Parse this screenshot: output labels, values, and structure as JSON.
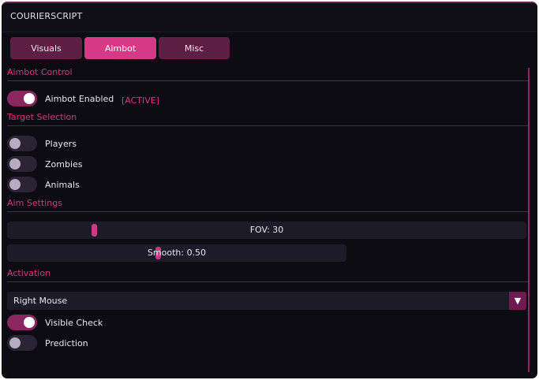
{
  "window": {
    "title": "COURIERSCRIPT"
  },
  "tabs": [
    {
      "label": "Visuals",
      "active": false
    },
    {
      "label": "Aimbot",
      "active": true
    },
    {
      "label": "Misc",
      "active": false
    }
  ],
  "colors": {
    "accent": "#cc3a83",
    "tab_active": "#d63a86",
    "tab_inactive": "#5d1f44",
    "background": "#0d0c12"
  },
  "aimbot_control": {
    "heading": "Aimbot Control",
    "aimbot_enabled": {
      "label": "Aimbot Enabled",
      "on": true,
      "status": "[ACTIVE]"
    }
  },
  "target_selection": {
    "heading": "Target Selection",
    "players": {
      "label": "Players",
      "on": false
    },
    "zombies": {
      "label": "Zombies",
      "on": false
    },
    "animals": {
      "label": "Animals",
      "on": false
    }
  },
  "aim_settings": {
    "heading": "Aim Settings",
    "fov": {
      "text": "FOV: 30",
      "value": 30,
      "fraction": 0.17
    },
    "smooth": {
      "text": "Smooth: 0.50",
      "value": 0.5,
      "fraction": 0.44
    }
  },
  "activation": {
    "heading": "Activation",
    "key_select": {
      "value": "Right Mouse",
      "arrow": "▼"
    },
    "visible_check": {
      "label": "Visible Check",
      "on": true
    },
    "prediction": {
      "label": "Prediction",
      "on": false
    }
  }
}
